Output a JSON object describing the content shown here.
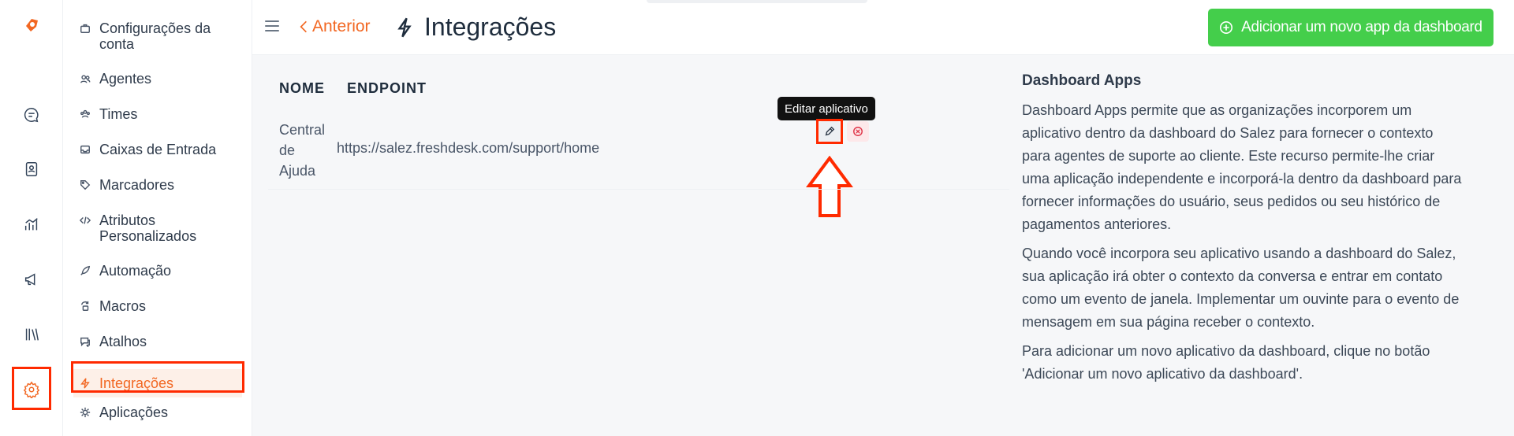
{
  "colors": {
    "accent": "#f26722",
    "primary_button": "#44ce4b",
    "highlight": "#ff2a00",
    "danger": "#e0364a"
  },
  "rail": {
    "items": [
      {
        "name": "chat",
        "icon": "chat-bubble-icon"
      },
      {
        "name": "contacts",
        "icon": "contact-book-icon"
      },
      {
        "name": "reports",
        "icon": "chart-icon"
      },
      {
        "name": "campaigns",
        "icon": "megaphone-icon"
      },
      {
        "name": "library",
        "icon": "library-icon"
      },
      {
        "name": "settings",
        "icon": "gear-icon",
        "active": true
      }
    ]
  },
  "sidebar": {
    "items": [
      {
        "label": "Configurações da conta",
        "icon": "briefcase-icon"
      },
      {
        "label": "Agentes",
        "icon": "people-icon"
      },
      {
        "label": "Times",
        "icon": "team-icon"
      },
      {
        "label": "Caixas de Entrada",
        "icon": "inbox-icon"
      },
      {
        "label": "Marcadores",
        "icon": "tag-icon"
      },
      {
        "label": "Atributos Personalizados",
        "icon": "code-icon"
      },
      {
        "label": "Automação",
        "icon": "rocket-icon"
      },
      {
        "label": "Macros",
        "icon": "macro-icon"
      },
      {
        "label": "Atalhos",
        "icon": "chat-reply-icon"
      },
      {
        "label": "Integrações",
        "icon": "lightning-icon",
        "active": true
      },
      {
        "label": "Aplicações",
        "icon": "apps-icon"
      }
    ]
  },
  "header": {
    "back_label": "Anterior",
    "title": "Integrações",
    "add_button_label": "Adicionar um novo app da dashboard"
  },
  "table": {
    "columns": [
      "NOME",
      "ENDPOINT"
    ],
    "rows": [
      {
        "name": "Central de Ajuda",
        "endpoint": "https://salez.freshdesk.com/support/home"
      }
    ],
    "edit_tooltip": "Editar aplicativo"
  },
  "info": {
    "title": "Dashboard Apps",
    "paragraphs": [
      "Dashboard Apps permite que as organizações incorporem um aplicativo dentro da dashboard do Salez para fornecer o contexto para agentes de suporte ao cliente. Este recurso permite-lhe criar uma aplicação independente e incorporá-la dentro da dashboard para fornecer informações do usuário, seus pedidos ou seu histórico de pagamentos anteriores.",
      "Quando você incorpora seu aplicativo usando a dashboard do Salez, sua aplicação irá obter o contexto da conversa e entrar em contato como um evento de janela. Implementar um ouvinte para o evento de mensagem em sua página receber o contexto.",
      "Para adicionar um novo aplicativo da dashboard, clique no botão 'Adicionar um novo aplicativo da dashboard'."
    ]
  }
}
